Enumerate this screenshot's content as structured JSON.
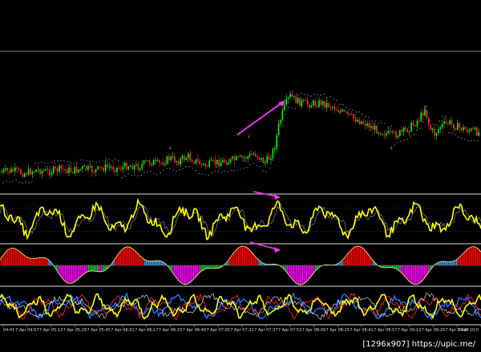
{
  "chart_data": {
    "type": "line",
    "panes": [
      {
        "name": "price",
        "kind": "candles"
      },
      {
        "name": "oscillator-1",
        "kind": "line",
        "color": "#ffff00"
      },
      {
        "name": "oscillator-2",
        "kind": "histogram",
        "colors": [
          "#ff0000",
          "#00cc33",
          "#3399ff",
          "#ff00ff"
        ]
      },
      {
        "name": "oscillator-3",
        "kind": "lines",
        "colors": [
          "#ffff00",
          "#2277ff",
          "#ff0000",
          "#ffffff"
        ]
      }
    ],
    "x_ticks": [
      "04:41",
      "7 Apr 04:57",
      "7 Apr 05:13",
      "7 Apr 05:29",
      "7 Apr 05:45",
      "7 Apr 06:01",
      "7 Apr 06:17",
      "7 Apr 06:33",
      "7 Apr 06:49",
      "7 Apr 07:05",
      "7 Apr 07:21",
      "7 Apr 07:37",
      "7 Apr 07:53",
      "7 Apr 08:09",
      "7 Apr 08:25",
      "7 Apr 08:41",
      "7 Apr 08:57",
      "7 Apr 09:13",
      "7 Apr 09:29",
      "7 Apr 09:45",
      "7 Apr 10:0"
    ],
    "price_profile": [
      [
        0,
        40
      ],
      [
        16,
        38
      ],
      [
        30,
        41
      ],
      [
        46,
        37
      ],
      [
        60,
        39
      ],
      [
        76,
        36
      ],
      [
        90,
        38
      ],
      [
        104,
        35
      ],
      [
        118,
        38
      ],
      [
        134,
        33
      ],
      [
        148,
        35
      ],
      [
        160,
        31
      ],
      [
        172,
        33
      ],
      [
        186,
        26
      ],
      [
        198,
        30
      ],
      [
        212,
        22
      ],
      [
        222,
        26
      ],
      [
        234,
        20
      ],
      [
        246,
        27
      ],
      [
        256,
        32
      ],
      [
        268,
        28
      ],
      [
        282,
        26
      ],
      [
        296,
        24
      ],
      [
        308,
        21
      ],
      [
        318,
        16
      ],
      [
        326,
        24
      ],
      [
        330,
        28
      ],
      [
        336,
        22
      ],
      [
        342,
        10
      ],
      [
        348,
        -20
      ],
      [
        356,
        -45
      ],
      [
        362,
        -55
      ],
      [
        372,
        -48
      ],
      [
        386,
        -45
      ],
      [
        400,
        -47
      ],
      [
        414,
        -43
      ],
      [
        426,
        -35
      ],
      [
        440,
        -28
      ],
      [
        454,
        -22
      ],
      [
        466,
        -15
      ],
      [
        478,
        -10
      ],
      [
        490,
        -6
      ],
      [
        502,
        -10
      ],
      [
        514,
        -18
      ],
      [
        524,
        -28
      ],
      [
        530,
        -40
      ],
      [
        536,
        -15
      ],
      [
        542,
        -8
      ],
      [
        550,
        -18
      ],
      [
        560,
        -22
      ],
      [
        572,
        -16
      ],
      [
        586,
        -12
      ],
      [
        598,
        -10
      ]
    ],
    "oscillator_1": {
      "ylim": [
        0,
        100
      ],
      "levels": [
        20,
        80
      ]
    },
    "oscillator_2": {
      "ylim": [
        -100,
        100
      ]
    },
    "oscillator_3": {
      "ylim": [
        0,
        100
      ]
    }
  },
  "watermark": "[1296x907] https://upic.me/"
}
